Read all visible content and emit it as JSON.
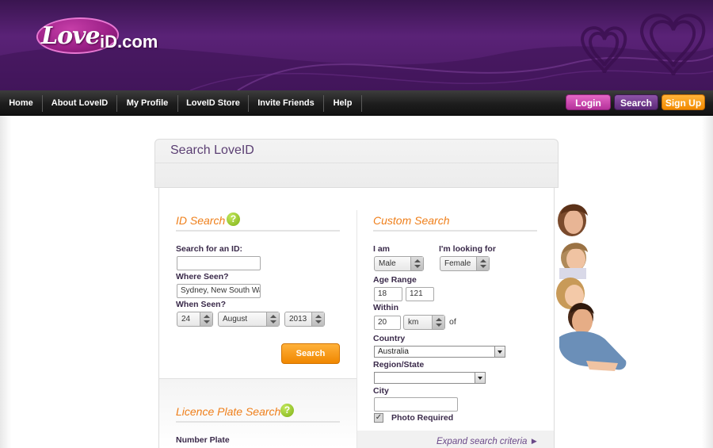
{
  "header": {
    "logo_love": "Love",
    "logo_id": "iD.com"
  },
  "nav": {
    "items": [
      "Home",
      "About LoveID",
      "My Profile",
      "LoveID Store",
      "Invite Friends",
      "Help"
    ],
    "login": "Login",
    "search": "Search",
    "signup": "Sign Up"
  },
  "panel": {
    "title": "Search LoveID",
    "id_search": {
      "title": "ID Search",
      "search_for_label": "Search for an ID:",
      "search_for_value": "",
      "where_seen_label": "Where Seen?",
      "where_seen_value": "Sydney, New South Wa",
      "when_seen_label": "When Seen?",
      "day": "24",
      "month": "August",
      "year": "2013",
      "button": "Search"
    },
    "plate_search": {
      "title": "Licence Plate Search",
      "number_plate_label": "Number Plate"
    },
    "custom_search": {
      "title": "Custom Search",
      "i_am_label": "I am",
      "i_am_value": "Male",
      "looking_for_label": "I'm looking for",
      "looking_for_value": "Female",
      "age_range_label": "Age Range",
      "age_min": "18",
      "age_max": "121",
      "within_label": "Within",
      "within_value": "20",
      "unit_value": "km",
      "of_label": "of",
      "country_label": "Country",
      "country_value": "Australia",
      "region_label": "Region/State",
      "region_value": "",
      "city_label": "City",
      "city_value": "",
      "photo_required_label": "Photo Required",
      "photo_required_checked": true,
      "expand_link": "Expand search criteria ►"
    }
  },
  "colors": {
    "accent_orange": "#ef7f1a",
    "purple_header": "#4a1a63",
    "help_green": "#8cc21f"
  }
}
